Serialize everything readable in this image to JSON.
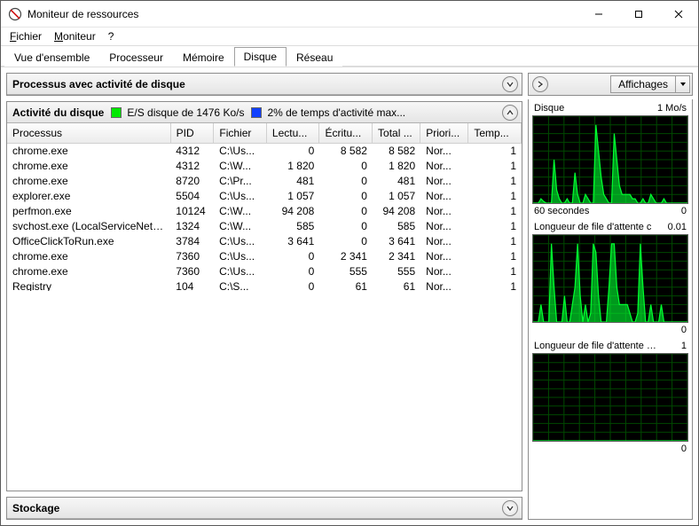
{
  "window": {
    "title": "Moniteur de ressources"
  },
  "menu": {
    "file": {
      "label": "Fichier",
      "underline_idx": 0
    },
    "monitor": {
      "label": "Moniteur",
      "underline_idx": 0
    },
    "help": {
      "label": "?"
    }
  },
  "tabs": {
    "overview": "Vue d'ensemble",
    "cpu": "Processeur",
    "memory": "Mémoire",
    "disk": "Disque",
    "network": "Réseau",
    "active": "disk"
  },
  "panels": {
    "processes": {
      "title": "Processus avec activité de disque"
    },
    "activity": {
      "title": "Activité du disque",
      "stat_io": "E/S disque de 1476 Ko/s",
      "stat_active": "2% de temps d'activité max...",
      "columns": {
        "image": "Processus",
        "pid": "PID",
        "file": "Fichier",
        "read": "Lectu...",
        "write": "Écritu...",
        "total": "Total ...",
        "priority": "Priori...",
        "resp": "Temp..."
      },
      "rows": [
        {
          "image": "chrome.exe",
          "pid": "4312",
          "file": "C:\\Us...",
          "read": "0",
          "write": "8 582",
          "total": "8 582",
          "priority": "Nor...",
          "resp": "1"
        },
        {
          "image": "chrome.exe",
          "pid": "4312",
          "file": "C:\\W...",
          "read": "1 820",
          "write": "0",
          "total": "1 820",
          "priority": "Nor...",
          "resp": "1"
        },
        {
          "image": "chrome.exe",
          "pid": "8720",
          "file": "C:\\Pr...",
          "read": "481",
          "write": "0",
          "total": "481",
          "priority": "Nor...",
          "resp": "1"
        },
        {
          "image": "explorer.exe",
          "pid": "5504",
          "file": "C:\\Us...",
          "read": "1 057",
          "write": "0",
          "total": "1 057",
          "priority": "Nor...",
          "resp": "1"
        },
        {
          "image": "perfmon.exe",
          "pid": "10124",
          "file": "C:\\W...",
          "read": "94 208",
          "write": "0",
          "total": "94 208",
          "priority": "Nor...",
          "resp": "1"
        },
        {
          "image": "svchost.exe (LocalServiceNetw...",
          "pid": "1324",
          "file": "C:\\W...",
          "read": "585",
          "write": "0",
          "total": "585",
          "priority": "Nor...",
          "resp": "1"
        },
        {
          "image": "OfficeClickToRun.exe",
          "pid": "3784",
          "file": "C:\\Us...",
          "read": "3 641",
          "write": "0",
          "total": "3 641",
          "priority": "Nor...",
          "resp": "1"
        },
        {
          "image": "chrome.exe",
          "pid": "7360",
          "file": "C:\\Us...",
          "read": "0",
          "write": "2 341",
          "total": "2 341",
          "priority": "Nor...",
          "resp": "1"
        },
        {
          "image": "chrome.exe",
          "pid": "7360",
          "file": "C:\\Us...",
          "read": "0",
          "write": "555",
          "total": "555",
          "priority": "Nor...",
          "resp": "1"
        },
        {
          "image": "Registry",
          "pid": "104",
          "file": "C:\\S...",
          "read": "0",
          "write": "61",
          "total": "61",
          "priority": "Nor...",
          "resp": "1"
        }
      ]
    },
    "storage": {
      "title": "Stockage"
    }
  },
  "right": {
    "views_label": "Affichages",
    "graph1": {
      "title": "Disque",
      "scale": "1 Mo/s",
      "footer_left": "60 secondes",
      "footer_right": "0"
    },
    "graph2": {
      "title": "Longueur de file d'attente c",
      "scale": "0.01",
      "footer_right": "0"
    },
    "graph3": {
      "title": "Longueur de file d'attente d...",
      "scale": "1",
      "footer_right": "0"
    }
  },
  "chart_data": [
    {
      "type": "line",
      "title": "Disque",
      "ylabel": "Mo/s",
      "ylim": [
        0,
        1
      ],
      "x_seconds": [
        60,
        0
      ],
      "values": [
        0,
        0,
        0,
        0.05,
        0.02,
        0,
        0,
        0,
        0.5,
        0.15,
        0.05,
        0,
        0,
        0.05,
        0,
        0,
        0.35,
        0.1,
        0,
        0,
        0.1,
        0.05,
        0,
        0,
        0.9,
        0.6,
        0.3,
        0.1,
        0.05,
        0,
        0,
        0.8,
        0.5,
        0.2,
        0.1,
        0.1,
        0.1,
        0.1,
        0.05,
        0.05,
        0,
        0,
        0.05,
        0,
        0,
        0.1,
        0.05,
        0,
        0,
        0,
        0.05,
        0,
        0,
        0,
        0,
        0,
        0,
        0,
        0,
        0
      ]
    },
    {
      "type": "line",
      "title": "Longueur de file d'attente c",
      "ylabel": "",
      "ylim": [
        0,
        0.01
      ],
      "x_seconds": [
        60,
        0
      ],
      "values": [
        0,
        0,
        0,
        0.002,
        0,
        0,
        0,
        0.009,
        0.004,
        0,
        0,
        0,
        0.003,
        0,
        0,
        0.002,
        0.004,
        0.009,
        0.003,
        0,
        0.002,
        0,
        0.001,
        0.009,
        0.008,
        0.003,
        0,
        0,
        0,
        0.004,
        0.009,
        0.009,
        0.004,
        0.002,
        0.002,
        0.002,
        0.002,
        0.001,
        0,
        0,
        0.001,
        0.009,
        0.004,
        0,
        0,
        0.002,
        0,
        0,
        0,
        0.002,
        0,
        0,
        0,
        0,
        0,
        0,
        0,
        0,
        0,
        0
      ]
    },
    {
      "type": "line",
      "title": "Longueur de file d'attente d",
      "ylabel": "",
      "ylim": [
        0,
        1
      ],
      "x_seconds": [
        60,
        0
      ],
      "values": [
        0,
        0,
        0,
        0,
        0,
        0,
        0,
        0,
        0,
        0,
        0,
        0,
        0,
        0,
        0,
        0,
        0,
        0,
        0,
        0,
        0,
        0,
        0,
        0,
        0,
        0,
        0,
        0,
        0,
        0,
        0,
        0,
        0,
        0,
        0,
        0,
        0,
        0,
        0,
        0,
        0,
        0,
        0,
        0,
        0,
        0,
        0,
        0,
        0,
        0,
        0,
        0,
        0,
        0,
        0,
        0,
        0,
        0,
        0,
        0
      ]
    }
  ]
}
